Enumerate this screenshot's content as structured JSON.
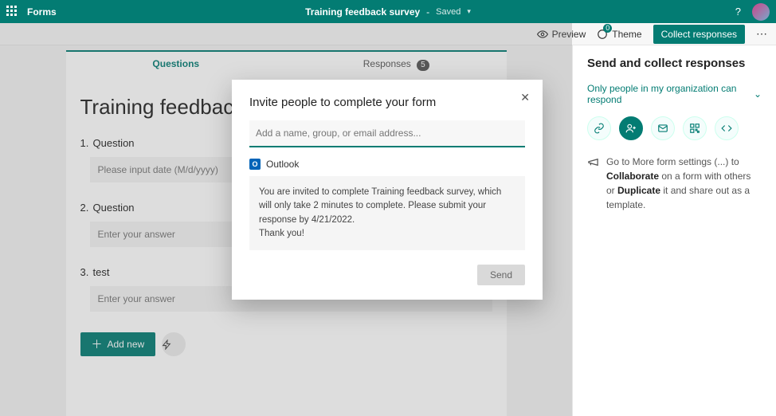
{
  "header": {
    "app_name": "Forms",
    "doc_title": "Training feedback survey",
    "save_status": "Saved"
  },
  "toolbar": {
    "preview": "Preview",
    "theme": "Theme",
    "theme_badge": "0",
    "collect": "Collect responses"
  },
  "tabs": {
    "questions": "Questions",
    "responses": "Responses",
    "responses_count": "5"
  },
  "form": {
    "title": "Training feedback survey",
    "q1_label": "Question",
    "q1_placeholder": "Please input date (M/d/yyyy)",
    "q2_label": "Question",
    "q2_placeholder": "Enter your answer",
    "q3_label": "test",
    "q3_placeholder": "Enter your answer",
    "add_new": "Add new"
  },
  "right": {
    "title": "Send and collect responses",
    "access": "Only people in my organization can respond",
    "tip_prefix": "Go to More form settings (...) to ",
    "tip_b1": "Collaborate",
    "tip_mid": " on a form with others or ",
    "tip_b2": "Duplicate",
    "tip_suffix": " it and share out as a template."
  },
  "modal": {
    "title": "Invite people to complete your form",
    "input_placeholder": "Add a name, group, or email address...",
    "outlook_label": "Outlook",
    "message": "You are invited to complete Training feedback survey, which will only take 2 minutes to complete. Please submit your response by 4/21/2022.\nThank you!",
    "send": "Send"
  }
}
